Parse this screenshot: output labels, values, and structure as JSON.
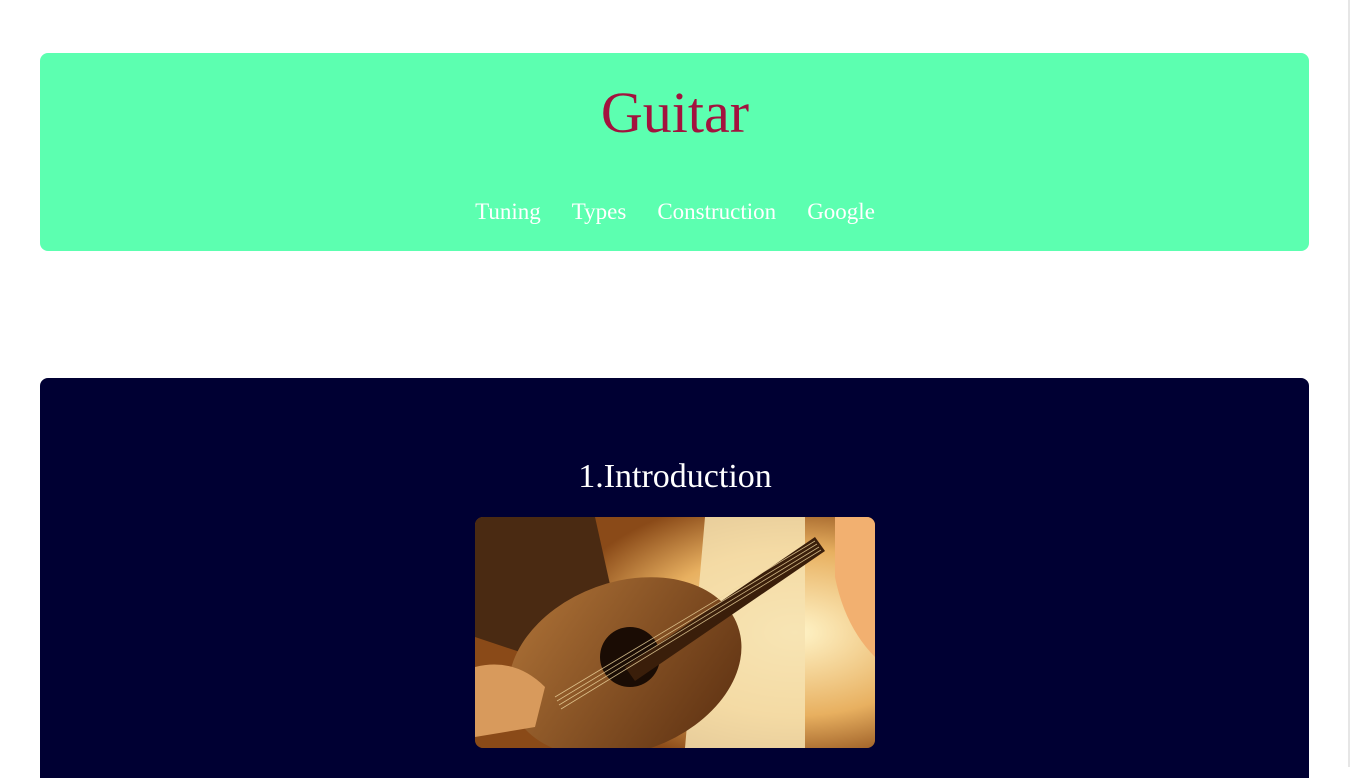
{
  "header": {
    "title": "Guitar",
    "nav": [
      {
        "label": "Tuning"
      },
      {
        "label": "Types"
      },
      {
        "label": "Construction"
      },
      {
        "label": "Google"
      }
    ]
  },
  "intro": {
    "heading": "1.Introduction",
    "image_icon": "guitar-photo"
  },
  "colors": {
    "header_bg": "#5cffb0",
    "title_color": "#a3123e",
    "section_bg": "#000033",
    "nav_text": "#ffffff"
  }
}
